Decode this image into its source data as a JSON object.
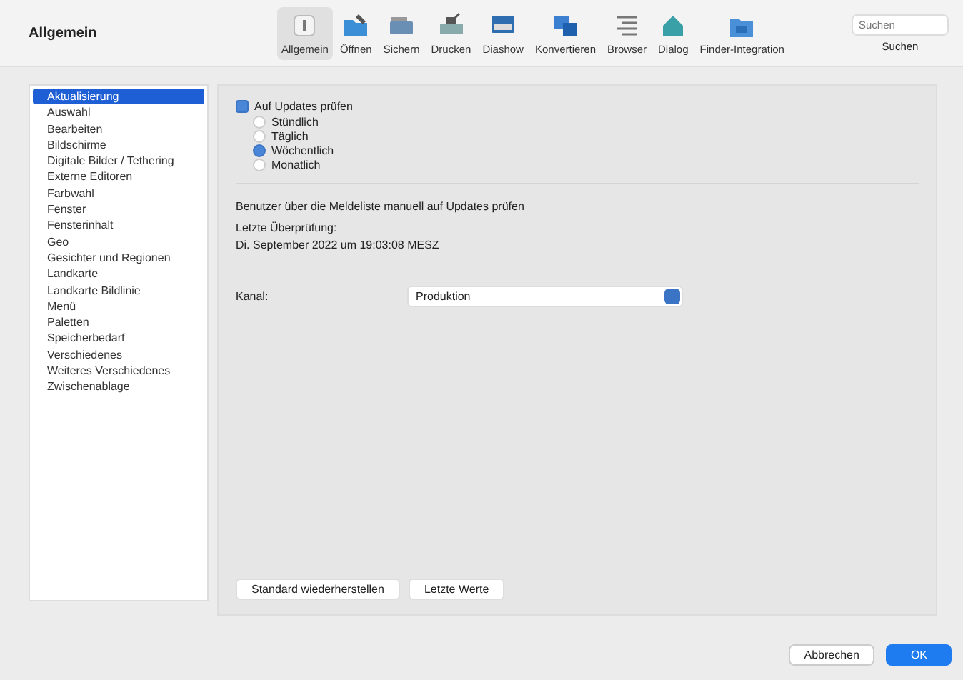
{
  "window": {
    "title": "Allgemein"
  },
  "toolbar": [
    {
      "label": "Allgemein",
      "selected": true
    },
    {
      "label": "Öffnen",
      "selected": false
    },
    {
      "label": "Sichern",
      "selected": false
    },
    {
      "label": "Drucken",
      "selected": false
    },
    {
      "label": "Diashow",
      "selected": false
    },
    {
      "label": "Konvertieren",
      "selected": false
    },
    {
      "label": "Browser",
      "selected": false
    },
    {
      "label": "Dialog",
      "selected": false
    },
    {
      "label": "Finder-Integration",
      "selected": false
    }
  ],
  "search": {
    "placeholder": "Suchen",
    "label": "Suchen"
  },
  "sidebar": {
    "items": [
      {
        "label": "Aktualisierung",
        "selected": true
      },
      {
        "label": "Auswahl",
        "selected": false
      },
      {
        "label": "Bearbeiten",
        "selected": false
      },
      {
        "label": "Bildschirme",
        "selected": false
      },
      {
        "label": "Digitale Bilder / Tethering",
        "selected": false
      },
      {
        "label": "Externe Editoren",
        "selected": false
      },
      {
        "label": "Farbwahl",
        "selected": false
      },
      {
        "label": "Fenster",
        "selected": false
      },
      {
        "label": "Fensterinhalt",
        "selected": false
      },
      {
        "label": "Geo",
        "selected": false
      },
      {
        "label": "Gesichter und Regionen",
        "selected": false
      },
      {
        "label": "Landkarte",
        "selected": false
      },
      {
        "label": "Landkarte Bildlinie",
        "selected": false
      },
      {
        "label": "Menü",
        "selected": false
      },
      {
        "label": "Paletten",
        "selected": false
      },
      {
        "label": "Speicherbedarf",
        "selected": false
      },
      {
        "label": "Verschiedenes",
        "selected": false
      },
      {
        "label": "Weiteres Verschiedenes",
        "selected": false
      },
      {
        "label": "Zwischenablage",
        "selected": false
      }
    ]
  },
  "update": {
    "checkbox": {
      "label": "Auf Updates prüfen",
      "checked": true
    },
    "intervals": [
      {
        "label": "Stündlich",
        "selected": false
      },
      {
        "label": "Täglich",
        "selected": false
      },
      {
        "label": "Wöchentlich",
        "selected": true
      },
      {
        "label": "Monatlich",
        "selected": false
      }
    ],
    "note": "Benutzer über die Meldeliste manuell auf Updates prüfen",
    "last_check_label": "Letzte Überprüfung:",
    "last_check": "Di. September 2022 um 19:03:08 MESZ",
    "channel_label": "Kanal:",
    "channel": "Produktion"
  },
  "panel_buttons": [
    "Standard wiederherstellen",
    "Letzte Werte"
  ],
  "dialog_buttons": [
    {
      "label": "Abbrechen",
      "kind": "secondary"
    },
    {
      "label": "OK",
      "kind": "primary"
    }
  ]
}
